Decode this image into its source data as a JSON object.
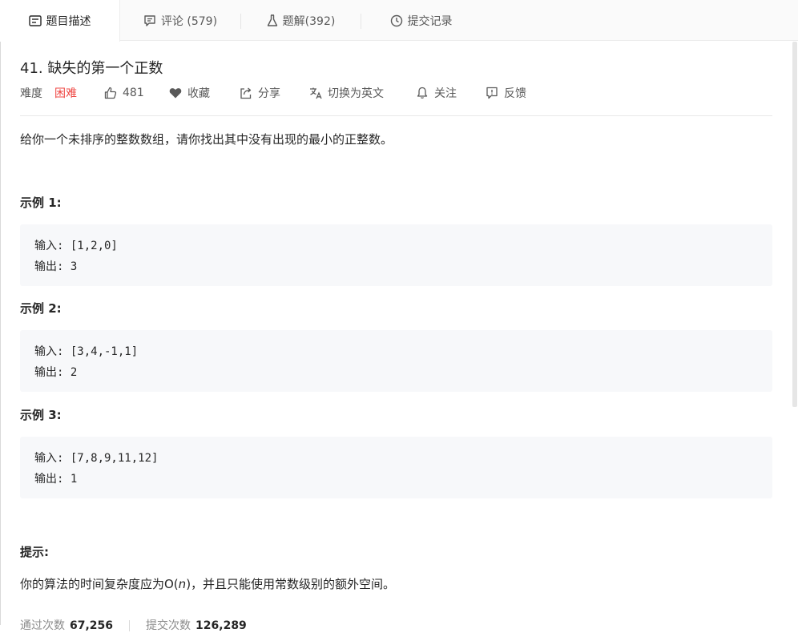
{
  "tabs": [
    {
      "label": "题目描述",
      "icon": "description-icon"
    },
    {
      "label": "评论 (579)",
      "icon": "comment-icon"
    },
    {
      "label": "题解(392)",
      "icon": "flask-icon"
    },
    {
      "label": "提交记录",
      "icon": "clock-icon"
    }
  ],
  "problem": {
    "title": "41. 缺失的第一个正数",
    "difficulty_label": "难度",
    "difficulty": "困难",
    "likes": "481",
    "favorite": "收藏",
    "share": "分享",
    "switch_lang": "切换为英文",
    "follow": "关注",
    "feedback": "反馈",
    "description": "给你一个未排序的整数数组，请你找出其中没有出现的最小的正整数。"
  },
  "examples": [
    {
      "title": "示例 1:",
      "input": "输入: [1,2,0]",
      "output": "输出: 3"
    },
    {
      "title": "示例 2:",
      "input": "输入: [3,4,-1,1]",
      "output": "输出: 2"
    },
    {
      "title": "示例 3:",
      "input": "输入: [7,8,9,11,12]",
      "output": "输出: 1"
    }
  ],
  "tip": {
    "title": "提示:",
    "text_before": "你的算法的时间复杂度应为O(",
    "text_var": "n",
    "text_after": ")，并且只能使用常数级别的额外空间。"
  },
  "stats": {
    "accepted_label": "通过次数",
    "accepted_value": "67,256",
    "submitted_label": "提交次数",
    "submitted_value": "126,289"
  },
  "colors": {
    "difficulty_hard": "#ef4743",
    "code_bg": "#f7f8fa"
  }
}
